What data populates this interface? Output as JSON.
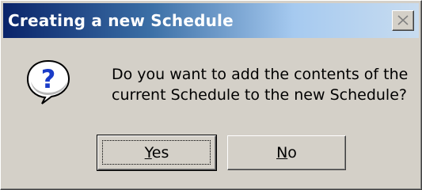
{
  "dialog": {
    "title": "Creating a new Schedule",
    "icon": "question-icon",
    "message_lines": [
      "Do you want to add the contents of the",
      "current Schedule to the new Schedule?"
    ],
    "buttons": {
      "yes": {
        "accel": "Y",
        "rest": "es"
      },
      "no": {
        "accel": "N",
        "rest": "o"
      }
    },
    "close_icon": "close-icon"
  },
  "colors": {
    "face": "#d4d0c8",
    "title_start": "#0a246a",
    "title_end": "#c8dcf0"
  }
}
